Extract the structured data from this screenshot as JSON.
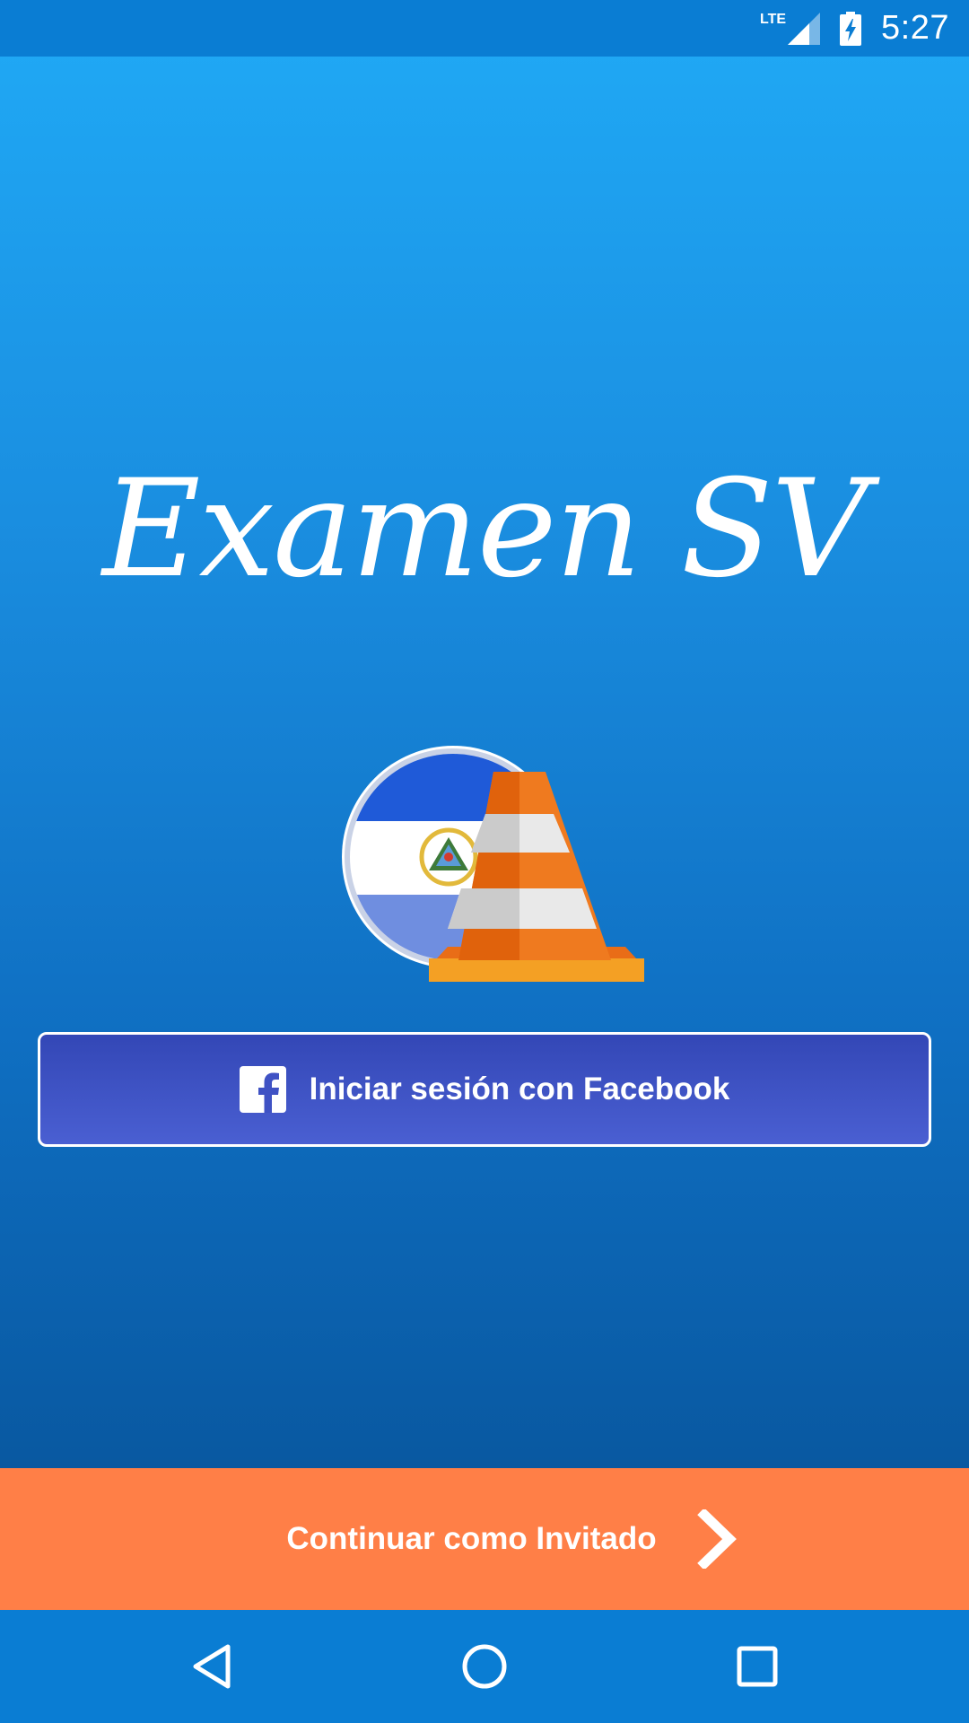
{
  "status_bar": {
    "network": "LTE",
    "time": "5:27",
    "icons": [
      "lte-signal-icon",
      "battery-charging-icon"
    ]
  },
  "app": {
    "title": "Examen SV"
  },
  "logo": {
    "icons": [
      "el-salvador-flag-icon",
      "traffic-cone-icon"
    ]
  },
  "facebook_button": {
    "label": "Iniciar sesión con Facebook",
    "icon": "facebook-icon"
  },
  "guest_button": {
    "label": "Continuar como Invitado",
    "icon": "chevron-right-icon"
  },
  "nav_bar": {
    "items": [
      "back-icon",
      "home-icon",
      "recents-icon"
    ]
  },
  "colors": {
    "status_bar": "#0a7dd3",
    "background_top": "#20aaf6",
    "background_bottom": "#054b8d",
    "facebook_button": "#3f52c4",
    "guest_bar": "#ff7f47",
    "nav_bar": "#0a7dd3",
    "cone_orange": "#ef7a1f",
    "flag_blue": "#1f5ad8"
  }
}
